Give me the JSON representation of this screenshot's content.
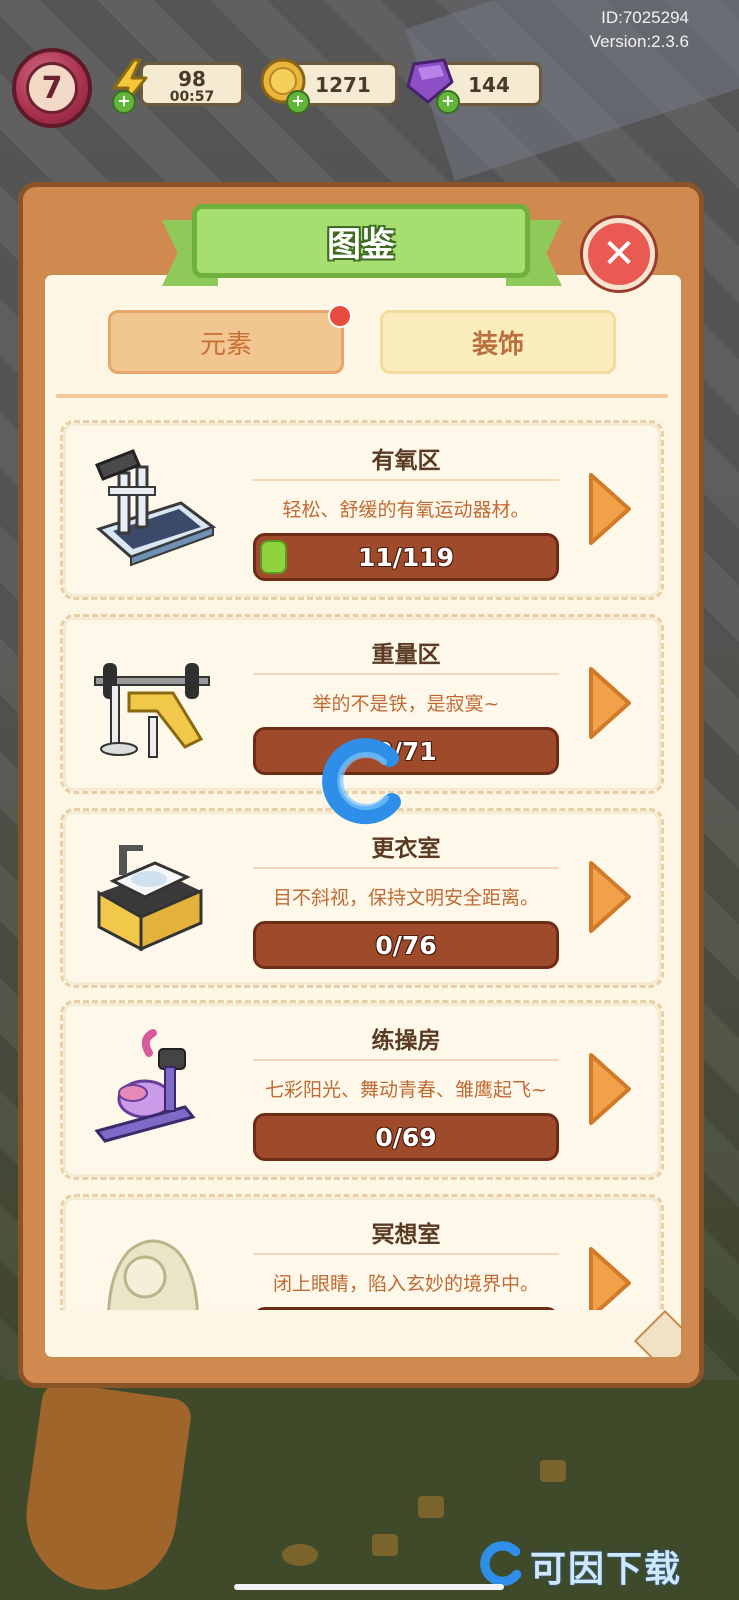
{
  "top_bar": {
    "id_text": "ID:7025294",
    "version_text": "Version:2.3.6",
    "level": "7",
    "energy": {
      "value": "98",
      "timer": "00:57",
      "icon": "lightning-icon"
    },
    "coins": {
      "value": "1271",
      "icon": "coin-icon"
    },
    "gems": {
      "value": "144",
      "icon": "gem-icon"
    }
  },
  "modal": {
    "title": "图鉴",
    "tabs": [
      {
        "label": "元素",
        "selected": true,
        "has_notification": true
      },
      {
        "label": "装饰",
        "selected": false
      }
    ],
    "items": [
      {
        "name": "有氧区",
        "desc": "轻松、舒缓的有氧运动器材。",
        "progress": "11/119",
        "progress_fraction": 0.092,
        "icon": "treadmill-icon"
      },
      {
        "name": "重量区",
        "desc": "举的不是铁，是寂寞~",
        "progress": "0/71",
        "progress_fraction": 0,
        "icon": "weight-bench-icon"
      },
      {
        "name": "更衣室",
        "desc": "目不斜视，保持文明安全距离。",
        "progress": "0/76",
        "progress_fraction": 0,
        "icon": "sink-icon"
      },
      {
        "name": "练操房",
        "desc": "七彩阳光、舞动青春、雏鹰起飞~",
        "progress": "0/69",
        "progress_fraction": 0,
        "icon": "exercise-bike-icon"
      },
      {
        "name": "冥想室",
        "desc": "闭上眼睛，陷入玄妙的境界中。",
        "progress": "",
        "progress_fraction": 0,
        "icon": "statue-icon"
      }
    ]
  },
  "watermark": {
    "text": "可因下载"
  },
  "colors": {
    "modal_frame": "#d08a4f",
    "panel_bg": "#fdf6e4",
    "title_green": "#a6de6f",
    "close_red": "#e85a52",
    "progress_bar": "#a04a2c",
    "progress_fill": "#8fd43e",
    "accent_orange": "#f0a24a"
  }
}
